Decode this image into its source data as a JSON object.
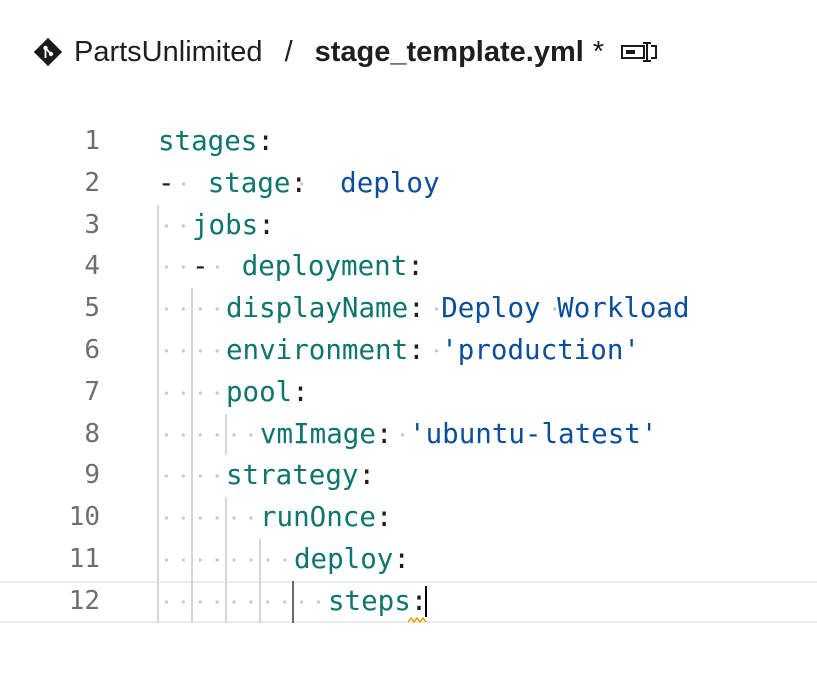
{
  "header": {
    "repo_icon": "git-diamond-icon",
    "repo_name": "PartsUnlimited",
    "separator": "/",
    "file_name": "stage_template.yml",
    "dirty_marker": "*",
    "rename_icon": "rename-icon"
  },
  "editor": {
    "lines": [
      {
        "number": "1",
        "key": "stages",
        "colon": ":",
        "value": ""
      },
      {
        "number": "2",
        "dash": "-",
        "key": "stage",
        "colon": ":",
        "value": "deploy"
      },
      {
        "number": "3",
        "key": "jobs",
        "colon": ":",
        "value": ""
      },
      {
        "number": "4",
        "dash": "-",
        "key": "deployment",
        "colon": ":",
        "value": ""
      },
      {
        "number": "5",
        "key": "displayName",
        "colon": ":",
        "value": "Deploy Workload"
      },
      {
        "number": "6",
        "key": "environment",
        "colon": ":",
        "value": "'production'"
      },
      {
        "number": "7",
        "key": "pool",
        "colon": ":",
        "value": ""
      },
      {
        "number": "8",
        "key": "vmImage",
        "colon": ":",
        "value": "'ubuntu-latest'"
      },
      {
        "number": "9",
        "key": "strategy",
        "colon": ":",
        "value": ""
      },
      {
        "number": "10",
        "key": "runOnce",
        "colon": ":",
        "value": ""
      },
      {
        "number": "11",
        "key": "deploy",
        "colon": ":",
        "value": ""
      },
      {
        "number": "12",
        "key": "steps",
        "colon": ":",
        "value": ""
      }
    ]
  },
  "colors": {
    "key": "#0f766e",
    "value": "#0b4f9c",
    "line_number": "#6e6e6e",
    "warning_squiggle": "#e5a100"
  }
}
